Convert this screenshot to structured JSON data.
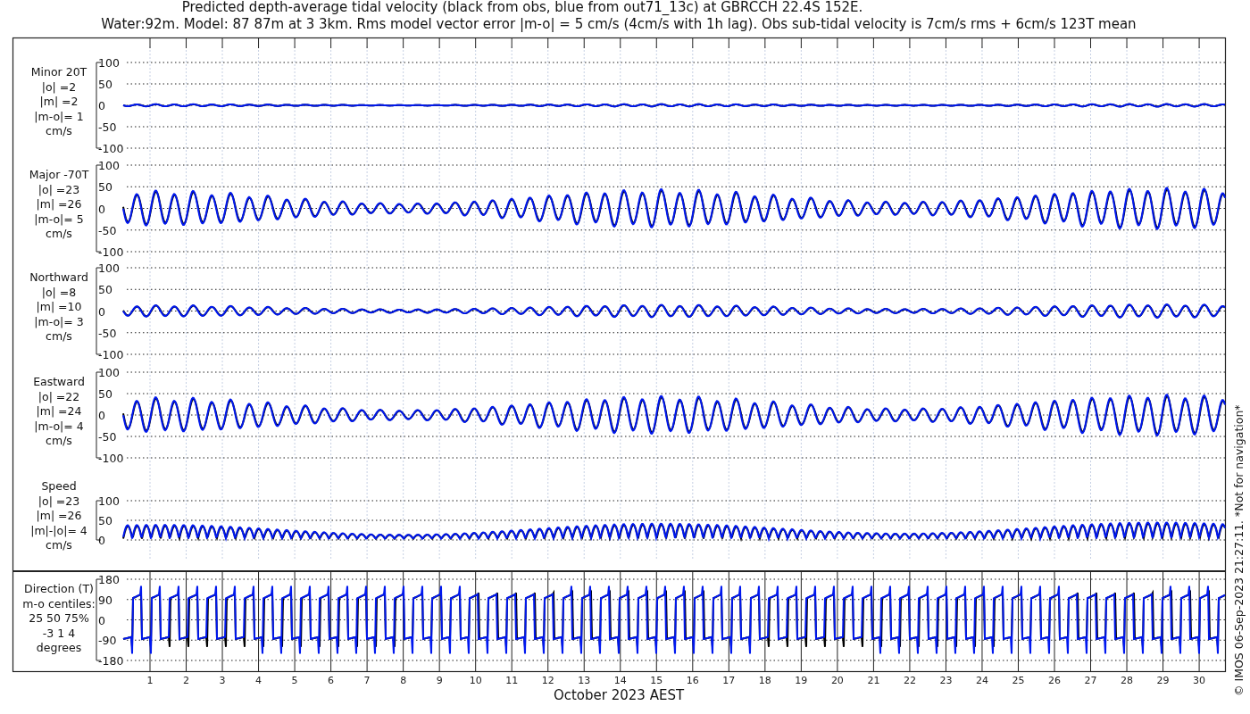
{
  "title_lines": [
    "Predicted depth-average tidal velocity (black from obs, blue from out71_13c) at GBRCCH 22.4S 152E.",
    "Water:92m. Model: 87 87m at 3 3km. Rms model vector error |m-o| = 5 cm/s (4cm/s with 1h lag). Obs sub-tidal velocity is 7cm/s rms + 6cm/s 123T mean"
  ],
  "panels": [
    {
      "kind": "minor",
      "label_lines": [
        "Minor 20T",
        "|o| =2",
        "|m| =2",
        "|m-o|= 1",
        "cm/s"
      ],
      "yticks": [
        "100",
        "50",
        "0",
        "-50",
        "-100"
      ]
    },
    {
      "kind": "major",
      "label_lines": [
        "Major -70T",
        "|o| =23",
        "|m| =26",
        "|m-o|= 5",
        "cm/s"
      ],
      "yticks": [
        "100",
        "50",
        "0",
        "-50",
        "-100"
      ]
    },
    {
      "kind": "northward",
      "label_lines": [
        "Northward",
        "|o| =8",
        "|m| =10",
        "|m-o|= 3",
        "cm/s"
      ],
      "yticks": [
        "100",
        "50",
        "0",
        "-50",
        "-100"
      ]
    },
    {
      "kind": "eastward",
      "label_lines": [
        "Eastward",
        "|o| =22",
        "|m| =24",
        "|m-o|= 4",
        "cm/s"
      ],
      "yticks": [
        "100",
        "50",
        "0",
        "-50",
        "-100"
      ]
    },
    {
      "kind": "speed",
      "label_lines": [
        "Speed",
        "|o| =23",
        "|m| =26",
        "|m|-|o|= 4",
        "cm/s"
      ],
      "yticks": [
        "100",
        "50",
        "0"
      ]
    },
    {
      "kind": "direction",
      "label_lines": [
        "Direction (T)",
        "m-o centiles:",
        "25  50  75%",
        "-3  1  4",
        "degrees"
      ],
      "yticks": [
        "180",
        "90",
        "0",
        "-90",
        "-180"
      ]
    }
  ],
  "x_axis": {
    "day_labels": [
      "1",
      "2",
      "3",
      "4",
      "5",
      "6",
      "7",
      "8",
      "9",
      "10",
      "11",
      "12",
      "13",
      "14",
      "15",
      "16",
      "17",
      "18",
      "19",
      "20",
      "21",
      "22",
      "23",
      "24",
      "25",
      "26",
      "27",
      "28",
      "29",
      "30"
    ],
    "label": "October 2023 AEST"
  },
  "copyright": "© IMOS 06-Sep-2023 21:27:11. *Not for navigation*"
}
